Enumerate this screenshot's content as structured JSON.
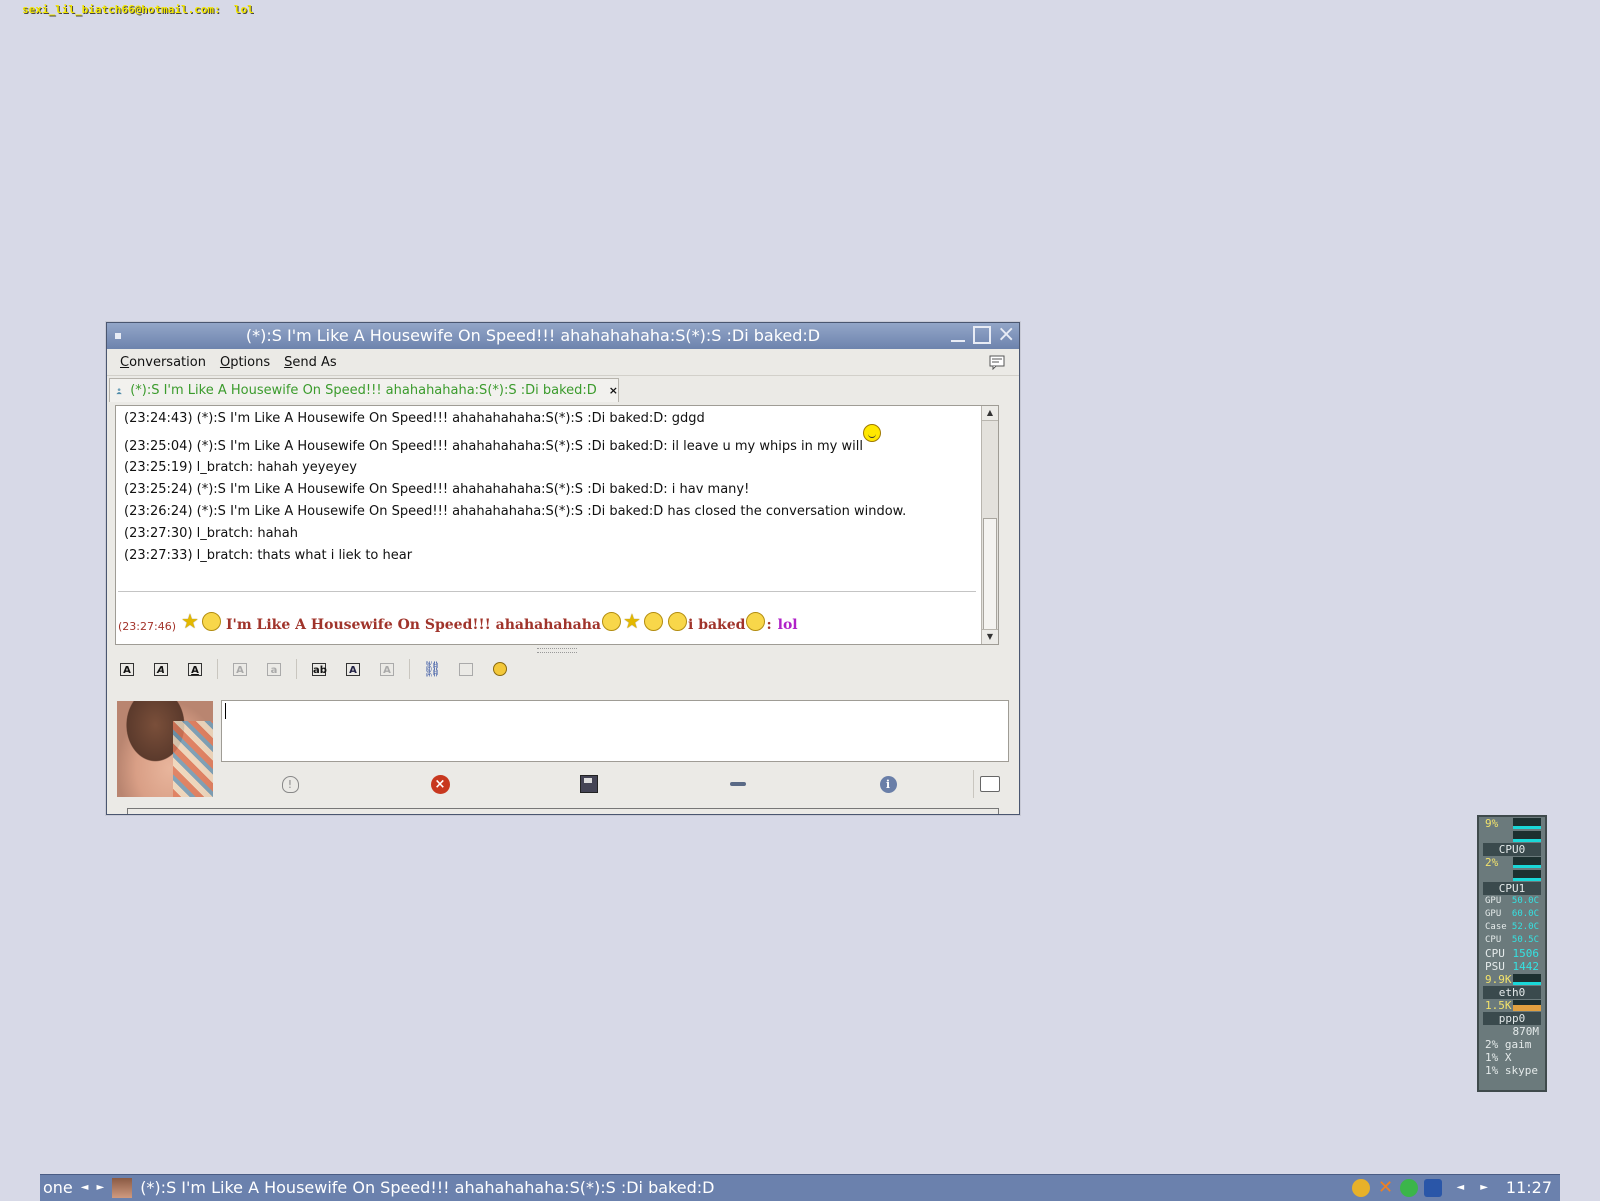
{
  "osd": {
    "text": "sexi_lil_biatch66@hotmail.com:  lol"
  },
  "window": {
    "title": "(*):S I'm Like A Housewife On Speed!!! ahahahahaha:S(*):S :Di baked:D"
  },
  "menu": [
    {
      "label": "Conversation",
      "accel": "C"
    },
    {
      "label": "Options",
      "accel": "O"
    },
    {
      "label": "Send As",
      "accel": "S"
    }
  ],
  "tab": {
    "label": "(*):S I'm Like A Housewife On Speed!!! ahahahahaha:S(*):S :Di baked:D",
    "close": "×"
  },
  "history": [
    {
      "text": "(23:24:43) (*):S I'm Like A Housewife On Speed!!! ahahahahaha:S(*):S :Di baked:D: gdgd"
    },
    {
      "text": "(23:25:04) (*):S I'm Like A Housewife On Speed!!! ahahahahaha:S(*):S :Di baked:D: il leave u my whips in my will"
    },
    {
      "text": "(23:25:19) l_bratch: hahah yeyeyey"
    },
    {
      "text": "(23:25:24) (*):S I'm Like A Housewife On Speed!!! ahahahahaha:S(*):S :Di baked:D: i hav many!"
    },
    {
      "text": "(23:26:24) (*):S I'm Like A Housewife On Speed!!! ahahahahaha:S(*):S :Di baked:D has closed the conversation window."
    },
    {
      "text": "(23:27:30) l_bratch: hahah"
    },
    {
      "text": "(23:27:33) l_bratch: thats what i liek to hear"
    }
  ],
  "status_line": {
    "timestamp": "(23:27:46)",
    "nick_a": "I'm Like A Housewife On Speed!!! ahahahahaha",
    "nick_b": "i baked",
    "sep": ":",
    "message": "lol"
  },
  "taskbar": {
    "desktop": "one",
    "task_title": "(*):S I'm Like A Housewife On Speed!!! ahahahahaha:S(*):S :Di baked:D",
    "clock": "11:27"
  },
  "sysmon": {
    "cpu0_pct": "9%",
    "cpu0_label": "CPU0",
    "cpu1_pct": "2%",
    "cpu1_label": "CPU1",
    "temps": [
      {
        "name": "GPU",
        "value": "50.0C"
      },
      {
        "name": "GPU",
        "value": "60.0C"
      },
      {
        "name": "Case",
        "value": "52.0C"
      },
      {
        "name": "CPU",
        "value": "50.5C"
      }
    ],
    "fans": [
      {
        "name": "CPU",
        "value": "1506"
      },
      {
        "name": "PSU",
        "value": "1442"
      }
    ],
    "eth0_rate": "9.9K",
    "eth0_label": "eth0",
    "ppp0_rate": "1.5K",
    "ppp0_label": "ppp0",
    "mem": "870M",
    "procs": [
      "2% gaim",
      "1% X",
      "1% skype"
    ]
  }
}
